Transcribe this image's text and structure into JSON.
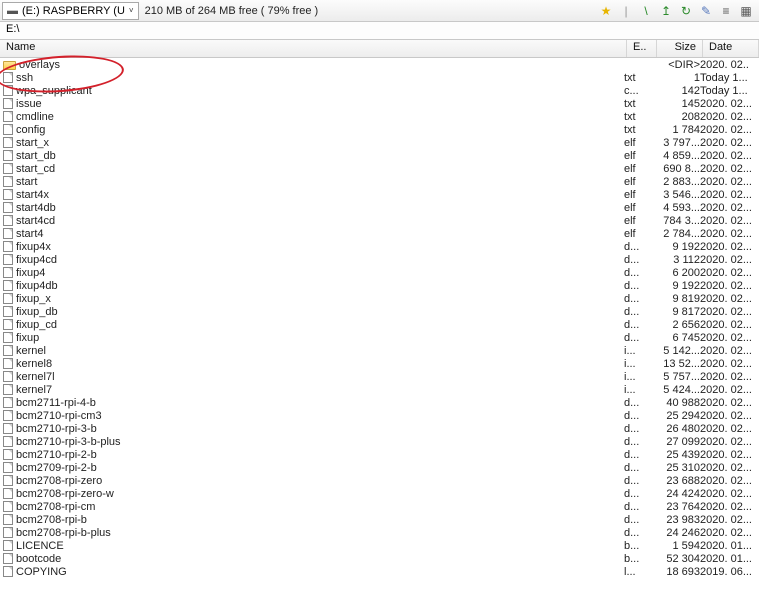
{
  "drive": {
    "label": "(E:) RASPBERRY (U",
    "caret": "˅"
  },
  "free_text": "210 MB of 264 MB free ( 79% free )",
  "path": "E:\\",
  "columns": {
    "name": "Name",
    "ext": "E..",
    "size": "Size",
    "date": "Date"
  },
  "icons": {
    "star": "★",
    "sep": "|",
    "root": "\\",
    "up": "↥",
    "refresh": "↻",
    "wand": "✎",
    "list": "≡",
    "grid": "▦"
  },
  "rows": [
    {
      "t": "folder",
      "n": "overlays",
      "e": "",
      "s": "<DIR>",
      "d": "2020. 02..",
      "hl": true
    },
    {
      "t": "file",
      "n": "ssh",
      "e": "txt",
      "s": "1",
      "d": "Today 1..."
    },
    {
      "t": "file",
      "n": "wpa_supplicant",
      "e": "c...",
      "s": "142",
      "d": "Today 1..."
    },
    {
      "t": "file",
      "n": "issue",
      "e": "txt",
      "s": "145",
      "d": "2020. 02..."
    },
    {
      "t": "file",
      "n": "cmdline",
      "e": "txt",
      "s": "208",
      "d": "2020. 02..."
    },
    {
      "t": "file",
      "n": "config",
      "e": "txt",
      "s": "1 784",
      "d": "2020. 02..."
    },
    {
      "t": "file",
      "n": "start_x",
      "e": "elf",
      "s": "3 797...",
      "d": "2020. 02..."
    },
    {
      "t": "file",
      "n": "start_db",
      "e": "elf",
      "s": "4 859...",
      "d": "2020. 02..."
    },
    {
      "t": "file",
      "n": "start_cd",
      "e": "elf",
      "s": "690 8...",
      "d": "2020. 02..."
    },
    {
      "t": "file",
      "n": "start",
      "e": "elf",
      "s": "2 883...",
      "d": "2020. 02..."
    },
    {
      "t": "file",
      "n": "start4x",
      "e": "elf",
      "s": "3 546...",
      "d": "2020. 02..."
    },
    {
      "t": "file",
      "n": "start4db",
      "e": "elf",
      "s": "4 593...",
      "d": "2020. 02..."
    },
    {
      "t": "file",
      "n": "start4cd",
      "e": "elf",
      "s": "784 3...",
      "d": "2020. 02..."
    },
    {
      "t": "file",
      "n": "start4",
      "e": "elf",
      "s": "2 784...",
      "d": "2020. 02..."
    },
    {
      "t": "file",
      "n": "fixup4x",
      "e": "d...",
      "s": "9 192",
      "d": "2020. 02..."
    },
    {
      "t": "file",
      "n": "fixup4cd",
      "e": "d...",
      "s": "3 112",
      "d": "2020. 02..."
    },
    {
      "t": "file",
      "n": "fixup4",
      "e": "d...",
      "s": "6 200",
      "d": "2020. 02..."
    },
    {
      "t": "file",
      "n": "fixup4db",
      "e": "d...",
      "s": "9 192",
      "d": "2020. 02..."
    },
    {
      "t": "file",
      "n": "fixup_x",
      "e": "d...",
      "s": "9 819",
      "d": "2020. 02..."
    },
    {
      "t": "file",
      "n": "fixup_db",
      "e": "d...",
      "s": "9 817",
      "d": "2020. 02..."
    },
    {
      "t": "file",
      "n": "fixup_cd",
      "e": "d...",
      "s": "2 656",
      "d": "2020. 02..."
    },
    {
      "t": "file",
      "n": "fixup",
      "e": "d...",
      "s": "6 745",
      "d": "2020. 02..."
    },
    {
      "t": "file",
      "n": "kernel",
      "e": "i...",
      "s": "5 142...",
      "d": "2020. 02..."
    },
    {
      "t": "file",
      "n": "kernel8",
      "e": "i...",
      "s": "13 52...",
      "d": "2020. 02..."
    },
    {
      "t": "file",
      "n": "kernel7l",
      "e": "i...",
      "s": "5 757...",
      "d": "2020. 02..."
    },
    {
      "t": "file",
      "n": "kernel7",
      "e": "i...",
      "s": "5 424...",
      "d": "2020. 02..."
    },
    {
      "t": "file",
      "n": "bcm2711-rpi-4-b",
      "e": "d...",
      "s": "40 988",
      "d": "2020. 02..."
    },
    {
      "t": "file",
      "n": "bcm2710-rpi-cm3",
      "e": "d...",
      "s": "25 294",
      "d": "2020. 02..."
    },
    {
      "t": "file",
      "n": "bcm2710-rpi-3-b",
      "e": "d...",
      "s": "26 480",
      "d": "2020. 02..."
    },
    {
      "t": "file",
      "n": "bcm2710-rpi-3-b-plus",
      "e": "d...",
      "s": "27 099",
      "d": "2020. 02..."
    },
    {
      "t": "file",
      "n": "bcm2710-rpi-2-b",
      "e": "d...",
      "s": "25 439",
      "d": "2020. 02..."
    },
    {
      "t": "file",
      "n": "bcm2709-rpi-2-b",
      "e": "d...",
      "s": "25 310",
      "d": "2020. 02..."
    },
    {
      "t": "file",
      "n": "bcm2708-rpi-zero",
      "e": "d...",
      "s": "23 688",
      "d": "2020. 02..."
    },
    {
      "t": "file",
      "n": "bcm2708-rpi-zero-w",
      "e": "d...",
      "s": "24 424",
      "d": "2020. 02..."
    },
    {
      "t": "file",
      "n": "bcm2708-rpi-cm",
      "e": "d...",
      "s": "23 764",
      "d": "2020. 02..."
    },
    {
      "t": "file",
      "n": "bcm2708-rpi-b",
      "e": "d...",
      "s": "23 983",
      "d": "2020. 02..."
    },
    {
      "t": "file",
      "n": "bcm2708-rpi-b-plus",
      "e": "d...",
      "s": "24 246",
      "d": "2020. 02..."
    },
    {
      "t": "file",
      "n": "LICENCE",
      "e": "b...",
      "s": "1 594",
      "d": "2020. 01..."
    },
    {
      "t": "file",
      "n": "bootcode",
      "e": "b...",
      "s": "52 304",
      "d": "2020. 01..."
    },
    {
      "t": "file",
      "n": "COPYING",
      "e": "l...",
      "s": "18 693",
      "d": "2019. 06..."
    }
  ]
}
